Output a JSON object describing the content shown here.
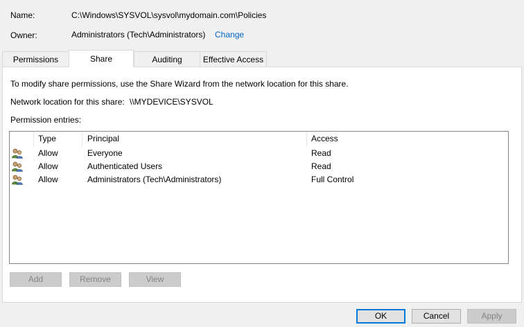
{
  "info": {
    "name_label": "Name:",
    "name_value": "C:\\Windows\\SYSVOL\\sysvol\\mydomain.com\\Policies",
    "owner_label": "Owner:",
    "owner_value": "Administrators (Tech\\Administrators)",
    "change_link": "Change"
  },
  "tabs": [
    {
      "label": "Permissions"
    },
    {
      "label": "Share",
      "active": true
    },
    {
      "label": "Auditing"
    },
    {
      "label": "Effective Access"
    }
  ],
  "share": {
    "instructions": "To modify share permissions, use the Share Wizard from the network location for this share.",
    "network_location_label": "Network location for this share:",
    "network_location_value": "\\\\MYDEVICE\\SYSVOL",
    "entries_label": "Permission entries:"
  },
  "table": {
    "columns": [
      "Type",
      "Principal",
      "Access"
    ],
    "rows": [
      {
        "icon": "users-group-icon",
        "type": "Allow",
        "principal": "Everyone",
        "access": "Read"
      },
      {
        "icon": "users-group-icon",
        "type": "Allow",
        "principal": "Authenticated Users",
        "access": "Read"
      },
      {
        "icon": "users-group-icon",
        "type": "Allow",
        "principal": "Administrators (Tech\\Administrators)",
        "access": "Full Control"
      }
    ]
  },
  "entry_buttons": {
    "add": "Add",
    "remove": "Remove",
    "view": "View"
  },
  "dialog_buttons": {
    "ok": "OK",
    "cancel": "Cancel",
    "apply": "Apply"
  },
  "colors": {
    "link": "#0066cc",
    "focus_border": "#0078d7"
  }
}
